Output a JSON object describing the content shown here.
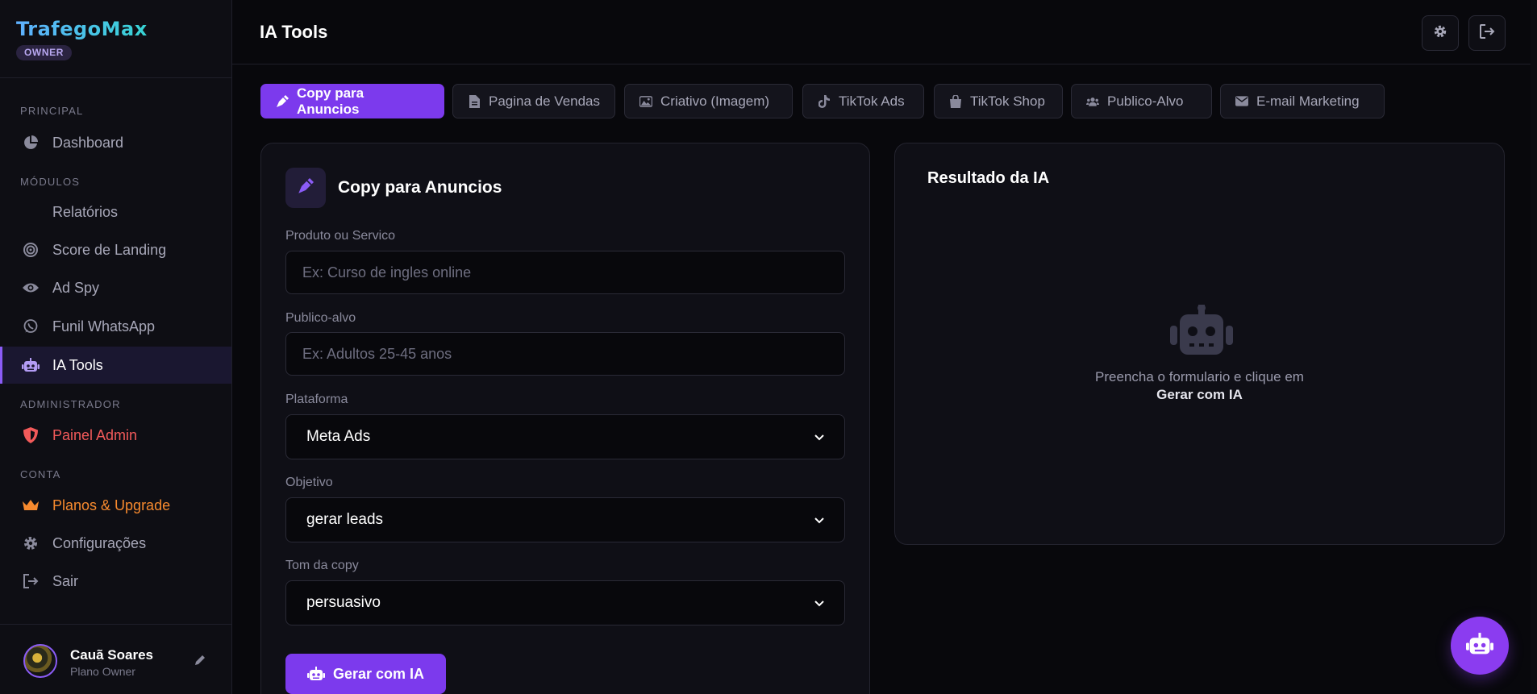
{
  "brand": {
    "name": "TrafegoMax",
    "role_badge": "OWNER"
  },
  "sidebar": {
    "sections": {
      "principal": "PRINCIPAL",
      "modulos": "MÓDULOS",
      "administrador": "ADMINISTRADOR",
      "conta": "CONTA"
    },
    "items": {
      "dashboard": "Dashboard",
      "relatorios": "Relatórios",
      "score": "Score de Landing",
      "adspy": "Ad Spy",
      "funil": "Funil WhatsApp",
      "iatools": "IA Tools",
      "admin": "Painel Admin",
      "planos": "Planos & Upgrade",
      "config": "Configurações",
      "sair": "Sair"
    },
    "user": {
      "name": "Cauã Soares",
      "plan": "Plano Owner"
    }
  },
  "header": {
    "title": "IA Tools"
  },
  "tabs": [
    {
      "label": "Copy para Anuncios",
      "icon": "pen-nib-icon",
      "active": true
    },
    {
      "label": "Pagina de Vendas",
      "icon": "file-icon"
    },
    {
      "label": "Criativo (Imagem)",
      "icon": "image-icon"
    },
    {
      "label": "TikTok Ads",
      "icon": "tiktok-icon"
    },
    {
      "label": "TikTok Shop",
      "icon": "shopping-bag-icon"
    },
    {
      "label": "Publico-Alvo",
      "icon": "users-icon"
    },
    {
      "label": "E-mail Marketing",
      "icon": "envelope-icon"
    }
  ],
  "form": {
    "title": "Copy para Anuncios",
    "produto": {
      "label": "Produto ou Servico",
      "placeholder": "Ex: Curso de ingles online"
    },
    "publico": {
      "label": "Publico-alvo",
      "placeholder": "Ex: Adultos 25-45 anos"
    },
    "plataforma": {
      "label": "Plataforma",
      "value": "Meta Ads"
    },
    "objetivo": {
      "label": "Objetivo",
      "value": "gerar leads"
    },
    "tom": {
      "label": "Tom da copy",
      "value": "persuasivo"
    },
    "submit_label": "Gerar com IA"
  },
  "result": {
    "title": "Resultado da IA",
    "empty_text": "Preencha o formulario e clique em",
    "empty_strong": "Gerar com IA"
  },
  "colors": {
    "accent": "#7c3aed",
    "admin": "#f25a5a",
    "upgrade": "#f78a2e",
    "background": "#08080c"
  }
}
